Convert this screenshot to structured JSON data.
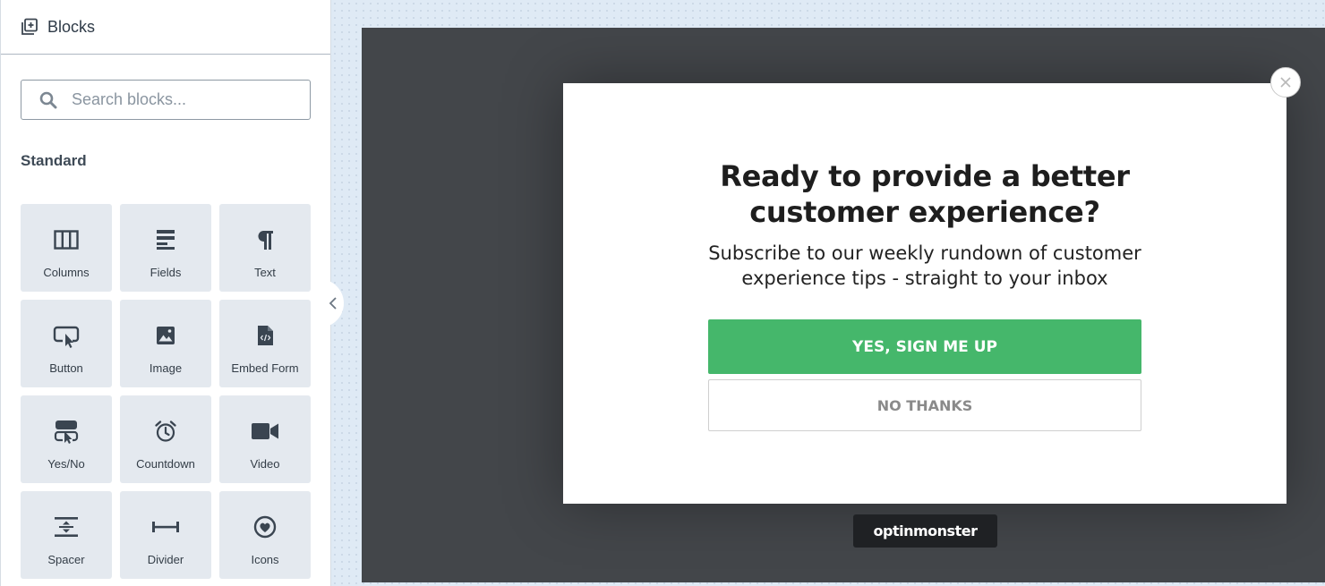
{
  "sidebar": {
    "title": "Blocks",
    "title_icon": "add-block-icon",
    "search": {
      "placeholder": "Search blocks...",
      "value": ""
    },
    "section_title": "Standard",
    "blocks": [
      {
        "label": "Columns",
        "icon": "columns-icon"
      },
      {
        "label": "Fields",
        "icon": "fields-icon"
      },
      {
        "label": "Text",
        "icon": "pilcrow-icon"
      },
      {
        "label": "Button",
        "icon": "button-cursor-icon"
      },
      {
        "label": "Image",
        "icon": "image-icon"
      },
      {
        "label": "Embed Form",
        "icon": "code-file-icon"
      },
      {
        "label": "Yes/No",
        "icon": "yes-no-icon"
      },
      {
        "label": "Countdown",
        "icon": "alarm-clock-icon"
      },
      {
        "label": "Video",
        "icon": "video-camera-icon"
      },
      {
        "label": "Spacer",
        "icon": "spacer-icon"
      },
      {
        "label": "Divider",
        "icon": "divider-icon"
      },
      {
        "label": "Icons",
        "icon": "heart-badge-icon"
      }
    ]
  },
  "popup": {
    "headline_line1": "Ready to provide a better",
    "headline_line2": "customer experience?",
    "subtext_line1": "Subscribe to our weekly rundown of customer",
    "subtext_line2": "experience tips - straight to your inbox",
    "yes_button": "YES, SIGN ME UP",
    "no_button": "NO THANKS",
    "badge": "optinmonster"
  },
  "colors": {
    "accent_green": "#45b76b",
    "tile_bg": "#e4e9ef",
    "preview_bg": "#43464a",
    "canvas_bg": "#dfeaf5"
  }
}
